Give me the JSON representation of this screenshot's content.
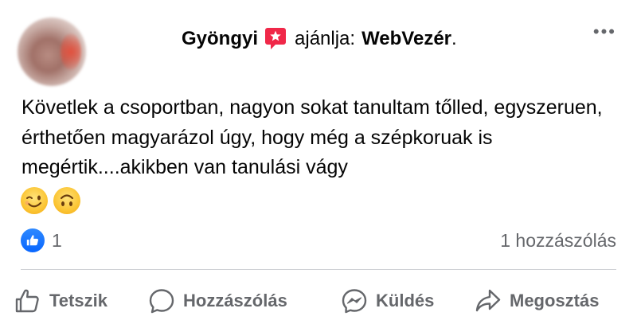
{
  "post": {
    "author": "Gyöngyi",
    "recommends_label": "ajánlja:",
    "page": "WebVezér",
    "page_suffix": ".",
    "more": "•••",
    "text": "Követlek a csoportban, nagyon sokat tanultam tőlled, egyszeruen, érthetően magyarázol úgy, hogy még a szépkoruak is megértik....akikben van tanulási vágy",
    "emojis": [
      "winking-face",
      "upside-down-face"
    ]
  },
  "reactions": {
    "like_count": "1",
    "comments_label": "1 hozzászólás"
  },
  "actions": {
    "like": "Tetszik",
    "comment": "Hozzászólás",
    "send": "Küldés",
    "share": "Megosztás"
  },
  "colors": {
    "accent_blue": "#0866ff",
    "recommend_red": "#f02849",
    "muted_text": "#65676b"
  }
}
